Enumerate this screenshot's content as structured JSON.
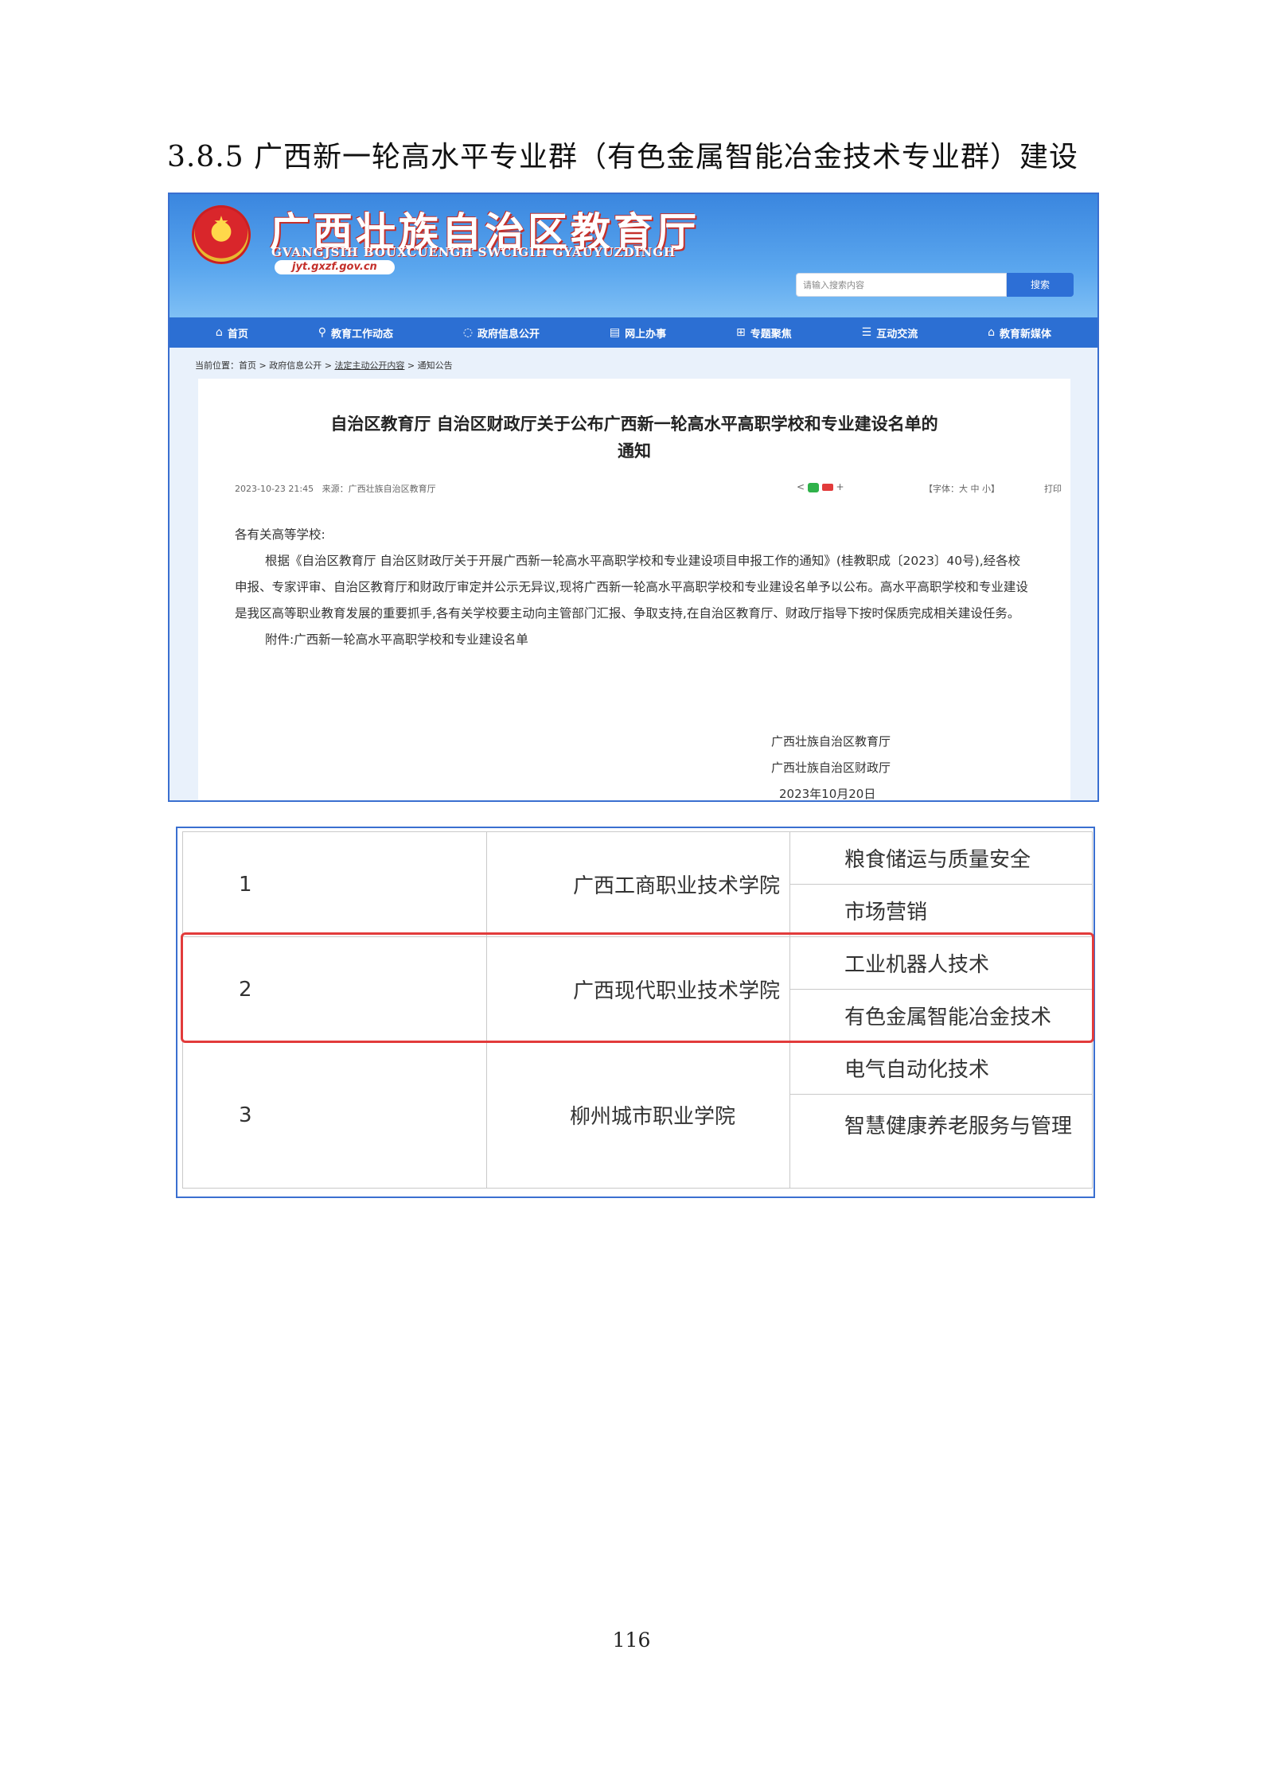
{
  "section_heading": "3.8.5 广西新一轮高水平专业群（有色金属智能冶金技术专业群）建设",
  "site": {
    "title": "广西壮族自治区教育厅",
    "subtitle": "GVANGJSIH BOUXCUENGH SWCIGIH GYAUYUZDINGH",
    "url": "jyt.gxzf.gov.cn",
    "search_placeholder": "请输入搜索内容",
    "search_button": "搜索"
  },
  "nav": [
    {
      "icon": "home-icon",
      "glyph": "⌂",
      "label": "首页"
    },
    {
      "icon": "network-icon",
      "glyph": "⚲",
      "label": "教育工作动态"
    },
    {
      "icon": "chat-icon",
      "glyph": "◌",
      "label": "政府信息公开"
    },
    {
      "icon": "document-icon",
      "glyph": "▤",
      "label": "网上办事"
    },
    {
      "icon": "grid-icon",
      "glyph": "⊞",
      "label": "专题聚焦"
    },
    {
      "icon": "comment-icon",
      "glyph": "☰",
      "label": "互动交流"
    },
    {
      "icon": "media-icon",
      "glyph": "⌂",
      "label": "教育新媒体"
    }
  ],
  "breadcrumb": {
    "prefix": "当前位置：",
    "home": "首页",
    "sep": " > ",
    "level1": "政府信息公开",
    "level2": "法定主动公开内容",
    "level3": "通知公告"
  },
  "article": {
    "title_line1": "自治区教育厅 自治区财政厅关于公布广西新一轮高水平高职学校和专业建设名单的",
    "title_line2": "通知",
    "date": "2023-10-23 21:45",
    "source": "来源：广西壮族自治区教育厅",
    "font_size_label": "【字体：大 中 小】",
    "print_label": "打印",
    "salutation": "各有关高等学校:",
    "para1": "根据《自治区教育厅 自治区财政厅关于开展广西新一轮高水平高职学校和专业建设项目申报工作的通知》(桂教职成〔2023〕40号),经各校申报、专家评审、自治区教育厅和财政厅审定并公示无异议,现将广西新一轮高水平高职学校和专业建设名单予以公布。高水平高职学校和专业建设是我区高等职业教育发展的重要抓手,各有关学校要主动向主管部门汇报、争取支持,在自治区教育厅、财政厅指导下按时保质完成相关建设任务。",
    "attachment": "附件:广西新一轮高水平高职学校和专业建设名单",
    "sign1": "广西壮族自治区教育厅",
    "sign2": "广西壮族自治区财政厅",
    "sign_date": "2023年10月20日"
  },
  "table": [
    {
      "num": "1",
      "school": "广西工商职业技术学院",
      "majors": [
        "粮食储运与质量安全",
        "市场营销"
      ]
    },
    {
      "num": "2",
      "school": "广西现代职业技术学院",
      "majors": [
        "工业机器人技术",
        "有色金属智能冶金技术"
      ]
    },
    {
      "num": "3",
      "school": "柳州城市职业学院",
      "majors": [
        "电气自动化技术",
        "智慧健康养老服务与管理"
      ]
    }
  ],
  "highlight_color": "#e23b3b",
  "page_number": "116"
}
